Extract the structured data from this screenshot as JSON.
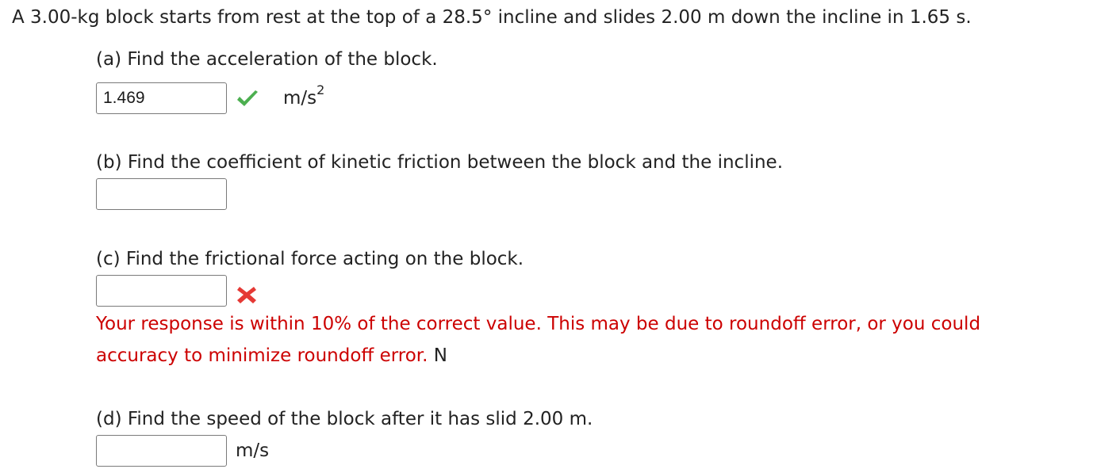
{
  "problem": {
    "text_before_angle": "A 3.00-kg block starts from rest at the top of a ",
    "angle": "28.5°",
    "text_after_angle": " incline and slides 2.00 m down the incline in ",
    "time": "1.65",
    "text_end": " s."
  },
  "parts": {
    "a": {
      "label": "(a) Find the acceleration of the block.",
      "value": "1.469",
      "unit": "m/s",
      "unit_sup": "2",
      "status_icon": "check-icon"
    },
    "b": {
      "label": "(b) Find the coefficient of kinetic friction between the block and the incline.",
      "value": ""
    },
    "c": {
      "label": "(c) Find the frictional force acting on the block.",
      "value": "",
      "status_icon": "cross-icon",
      "feedback_line1": "Your response is within 10% of the correct value. This may be due to roundoff error, or you could",
      "feedback_line2": "accuracy to minimize roundoff error.",
      "unit": "N"
    },
    "d": {
      "label": "(d) Find the speed of the block after it has slid 2.00 m.",
      "value": "",
      "unit": "m/s"
    }
  },
  "colors": {
    "check": "#4caf50",
    "cross": "#e53935",
    "feedback": "#cc0000"
  }
}
